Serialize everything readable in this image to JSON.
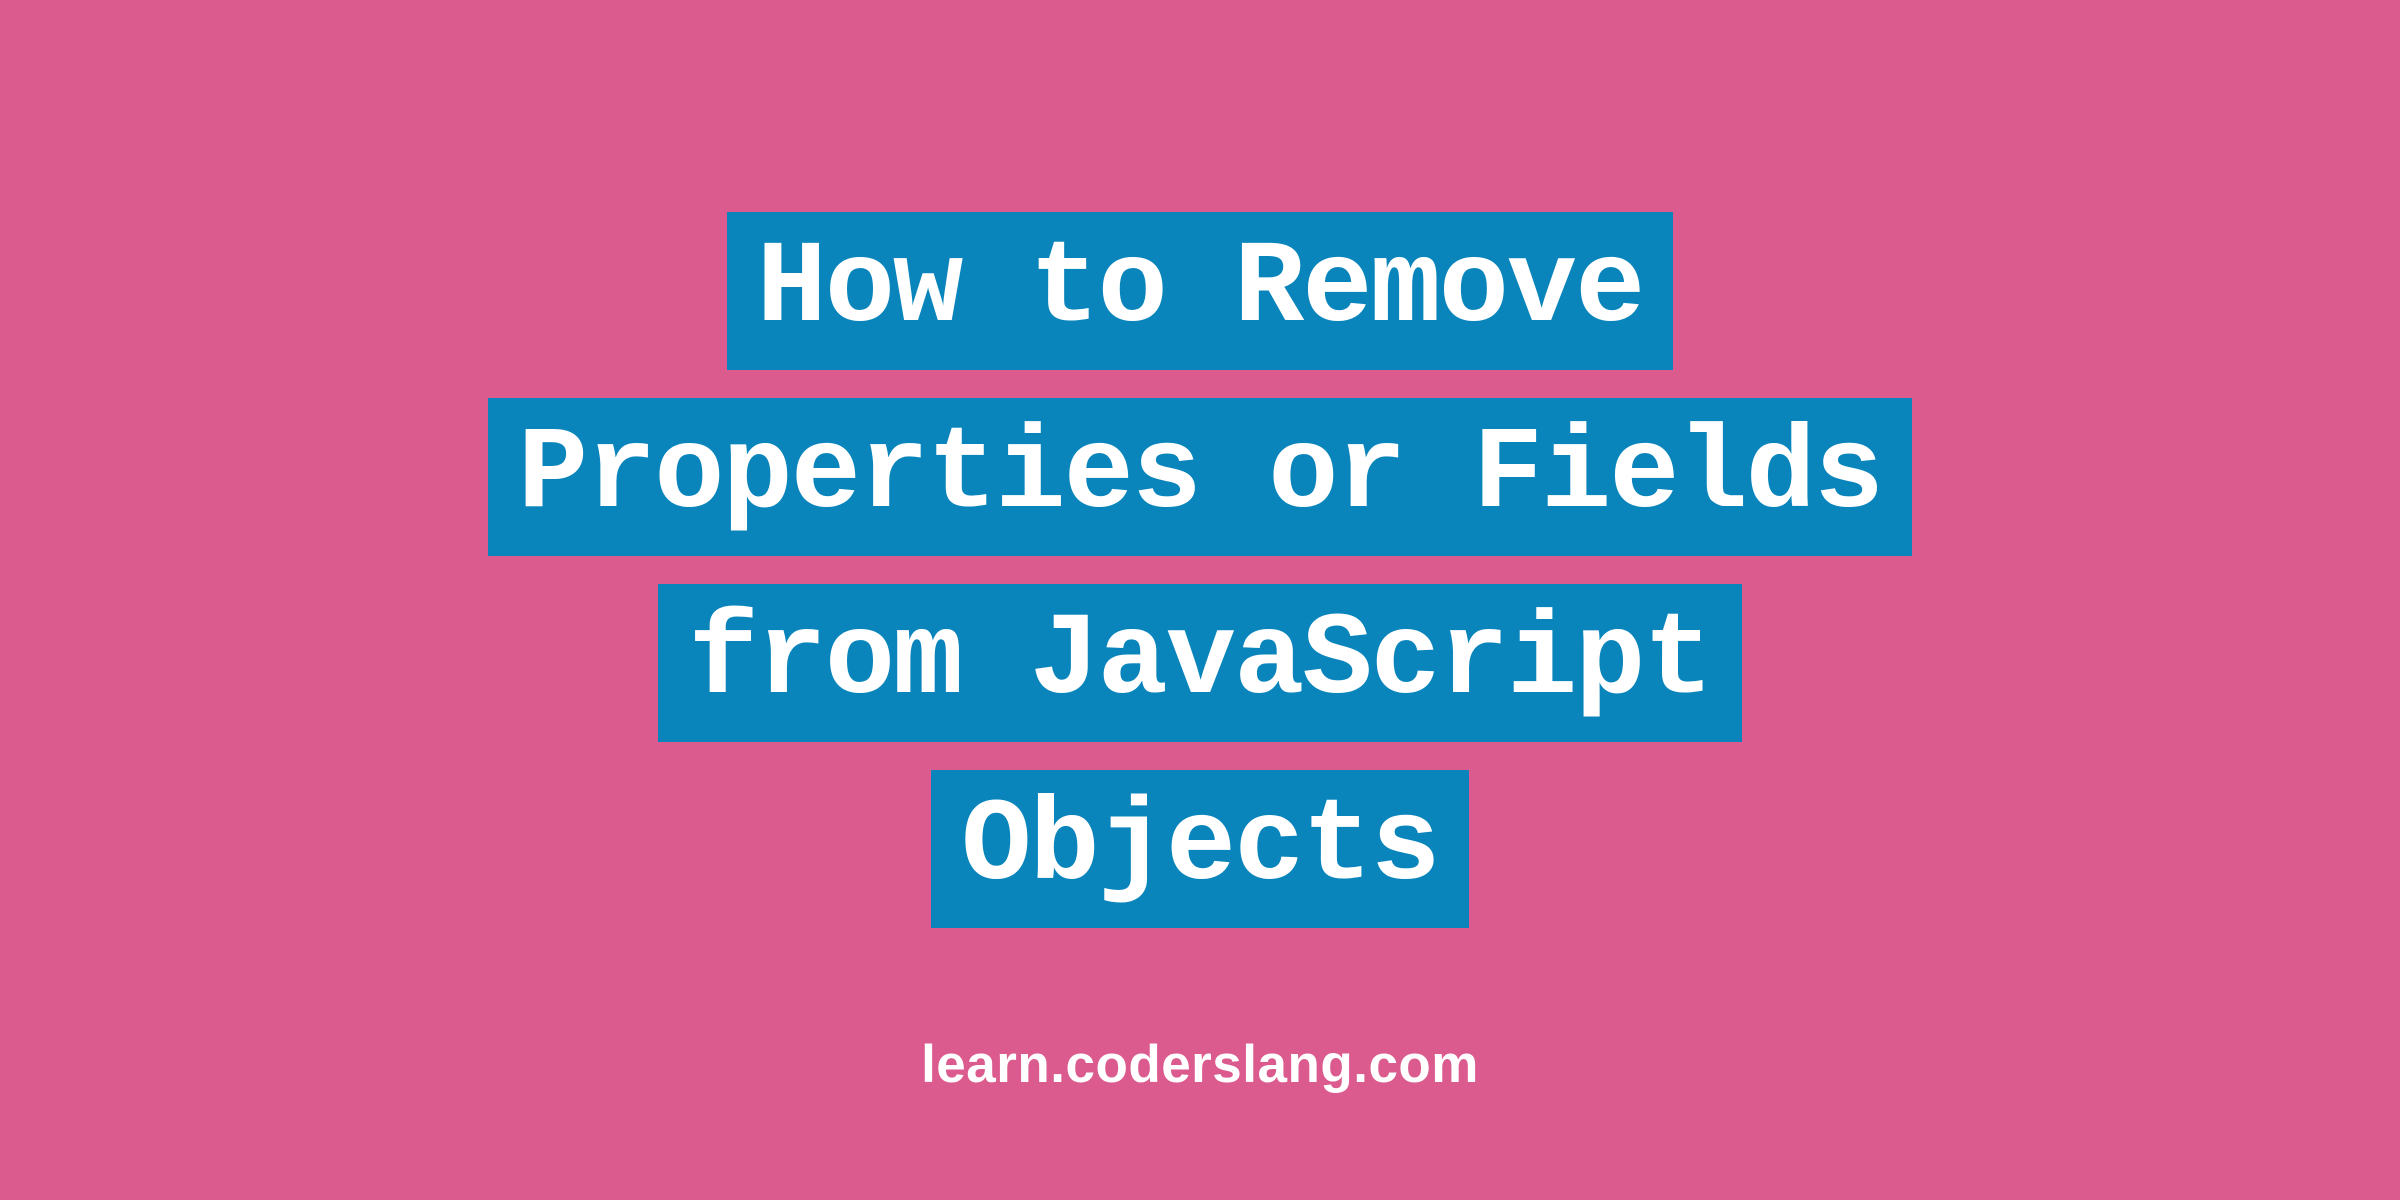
{
  "title": {
    "lines": [
      "How to Remove",
      "Properties or Fields",
      "from JavaScript",
      "Objects"
    ]
  },
  "footer": {
    "url": "learn.coderslang.com"
  },
  "colors": {
    "background": "#dc5b8f",
    "highlight": "#0a85bc",
    "text": "#ffffff"
  }
}
